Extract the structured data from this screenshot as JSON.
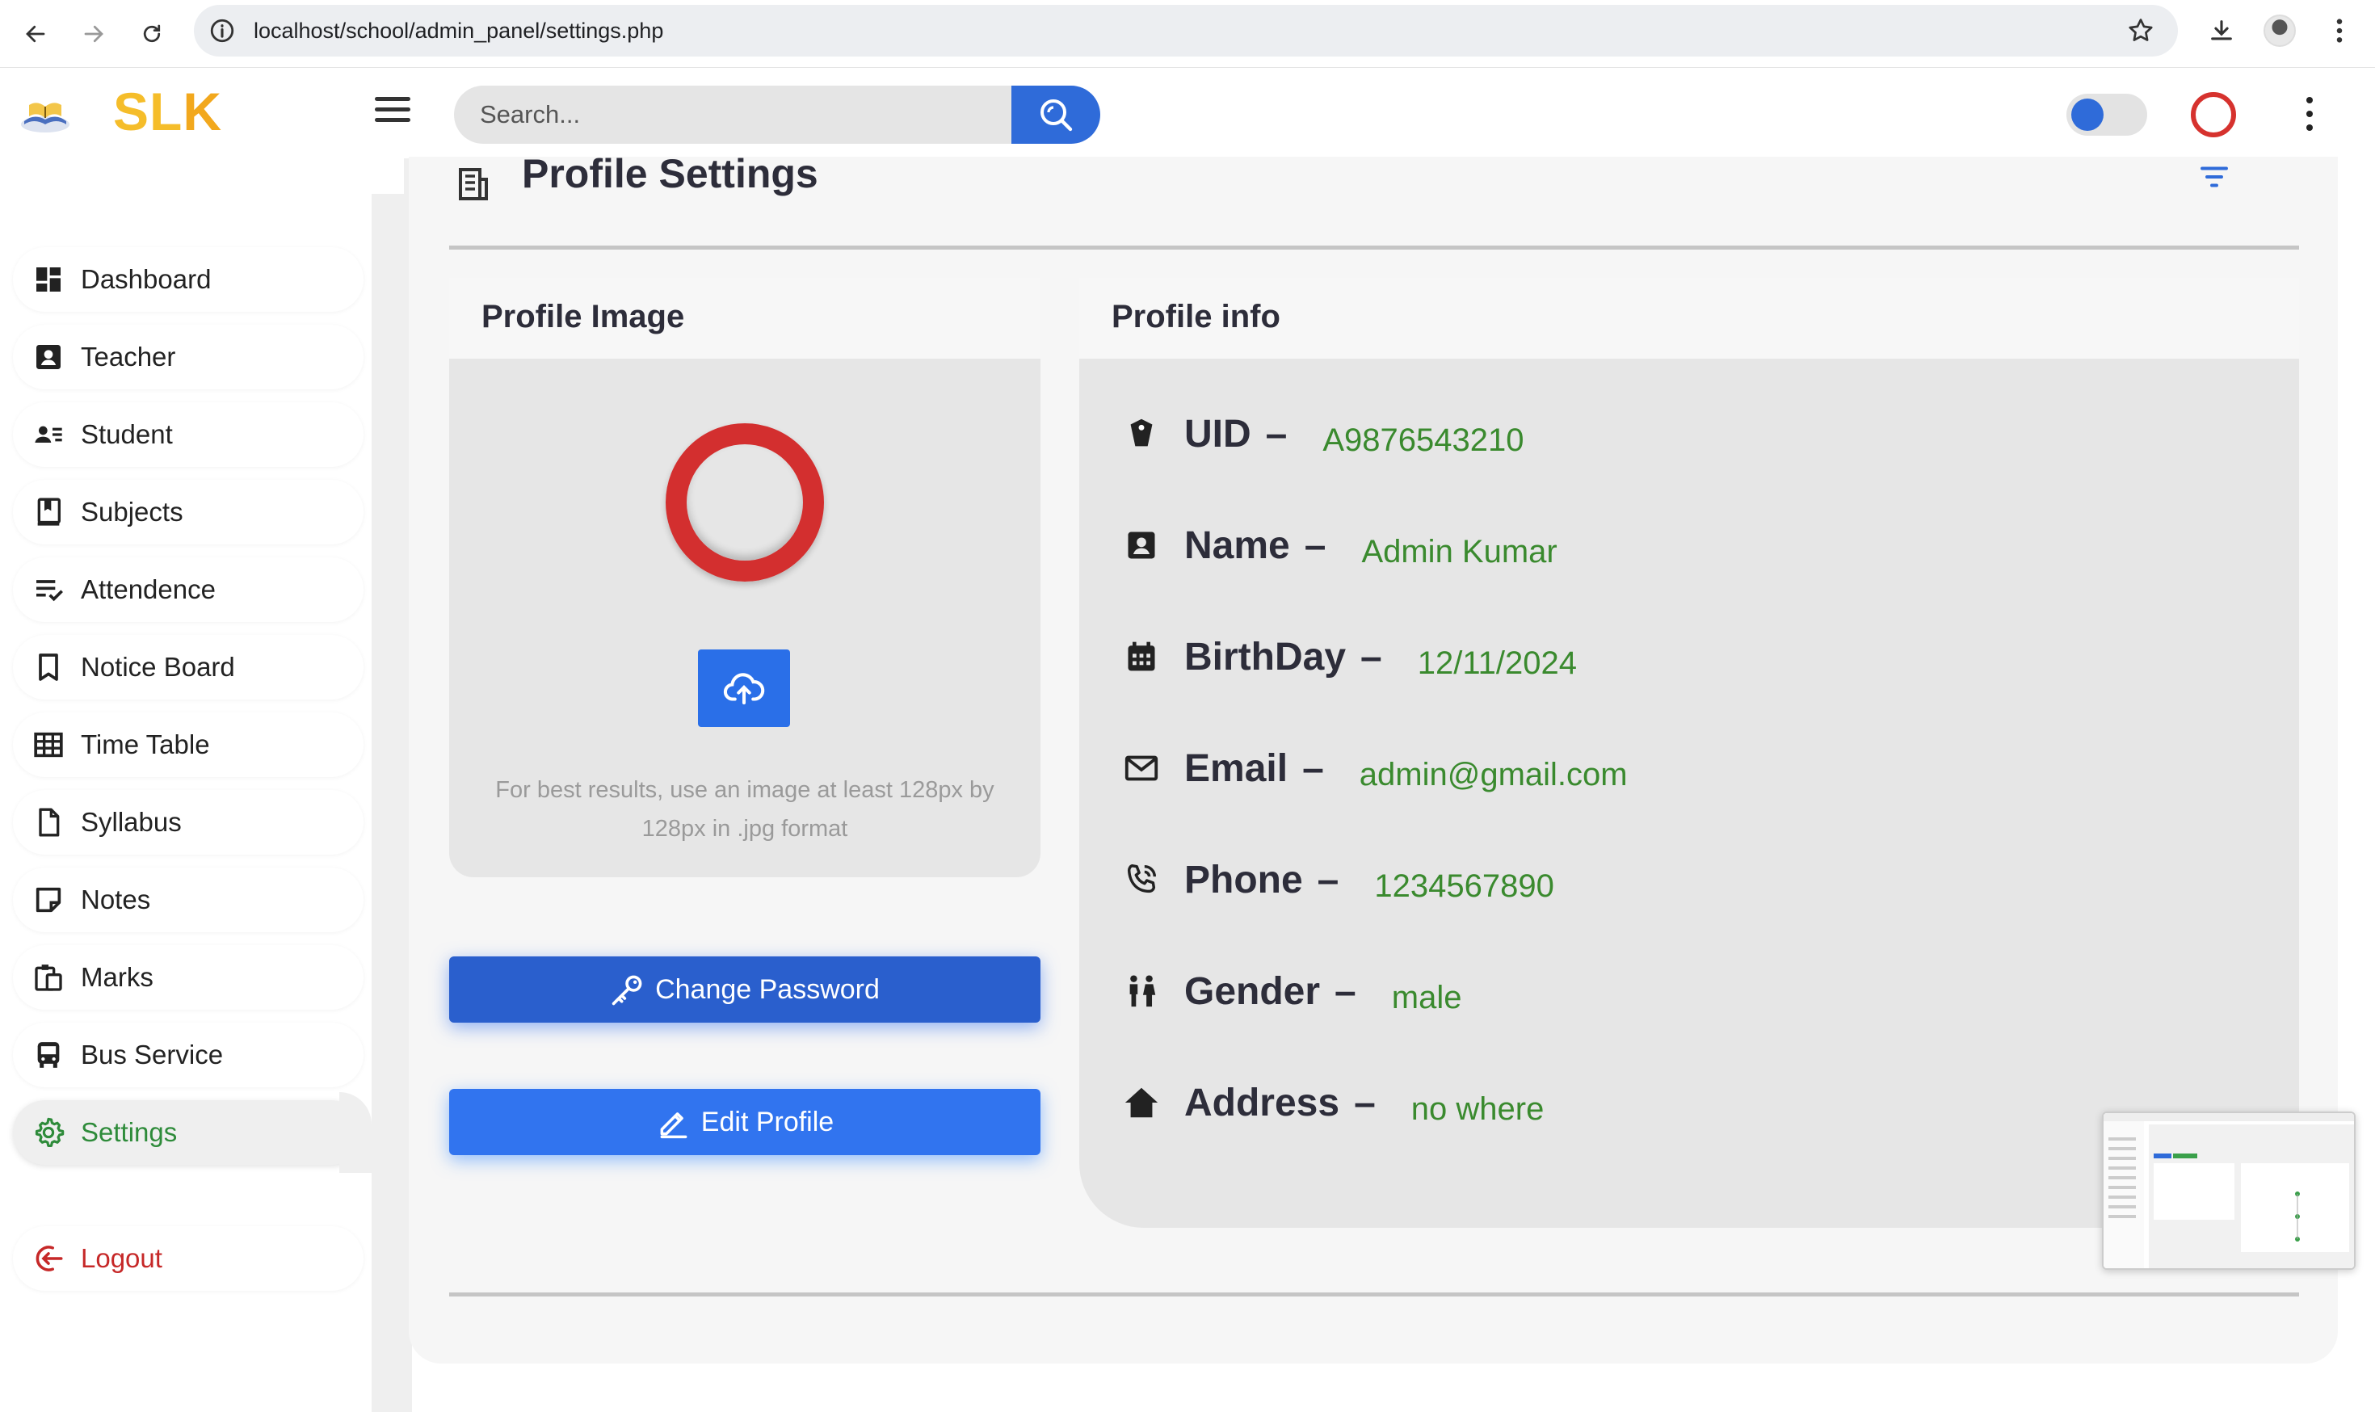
{
  "browser": {
    "url": "localhost/school/admin_panel/settings.php"
  },
  "app": {
    "brand_primary": "SL",
    "brand_accent": "K",
    "search_placeholder": "Search...",
    "accent_color": "#2f6bd9"
  },
  "sidebar": {
    "items": [
      {
        "label": "Dashboard",
        "icon": "dashboard-icon"
      },
      {
        "label": "Teacher",
        "icon": "teacher-icon"
      },
      {
        "label": "Student",
        "icon": "student-icon"
      },
      {
        "label": "Subjects",
        "icon": "book-icon"
      },
      {
        "label": "Attendence",
        "icon": "attendance-icon"
      },
      {
        "label": "Notice Board",
        "icon": "bookmark-icon"
      },
      {
        "label": "Time Table",
        "icon": "grid-icon"
      },
      {
        "label": "Syllabus",
        "icon": "file-icon"
      },
      {
        "label": "Notes",
        "icon": "note-icon"
      },
      {
        "label": "Marks",
        "icon": "clipboard-icon"
      },
      {
        "label": "Bus Service",
        "icon": "bus-icon"
      },
      {
        "label": "Settings",
        "icon": "gear-icon",
        "active": true
      }
    ],
    "logout": "Logout"
  },
  "page": {
    "title": "Profile Settings"
  },
  "profile_image": {
    "title": "Profile Image",
    "hint": "For best results, use an image at least 128px by 128px in .jpg format"
  },
  "actions": {
    "change_password": "Change Password",
    "edit_profile": "Edit Profile"
  },
  "profile_info": {
    "title": "Profile info",
    "fields": [
      {
        "key": "UID",
        "value": "A9876543210",
        "icon": "id-tag-icon"
      },
      {
        "key": "Name",
        "value": "Admin Kumar",
        "icon": "contact-icon"
      },
      {
        "key": "BirthDay",
        "value": "12/11/2024",
        "icon": "calendar-icon"
      },
      {
        "key": "Email",
        "value": "admin@gmail.com",
        "icon": "mail-icon"
      },
      {
        "key": "Phone",
        "value": "1234567890",
        "icon": "phone-icon"
      },
      {
        "key": "Gender",
        "value": "male",
        "icon": "people-icon"
      },
      {
        "key": "Address",
        "value": "no where",
        "icon": "home-icon"
      }
    ],
    "dash": "–"
  }
}
